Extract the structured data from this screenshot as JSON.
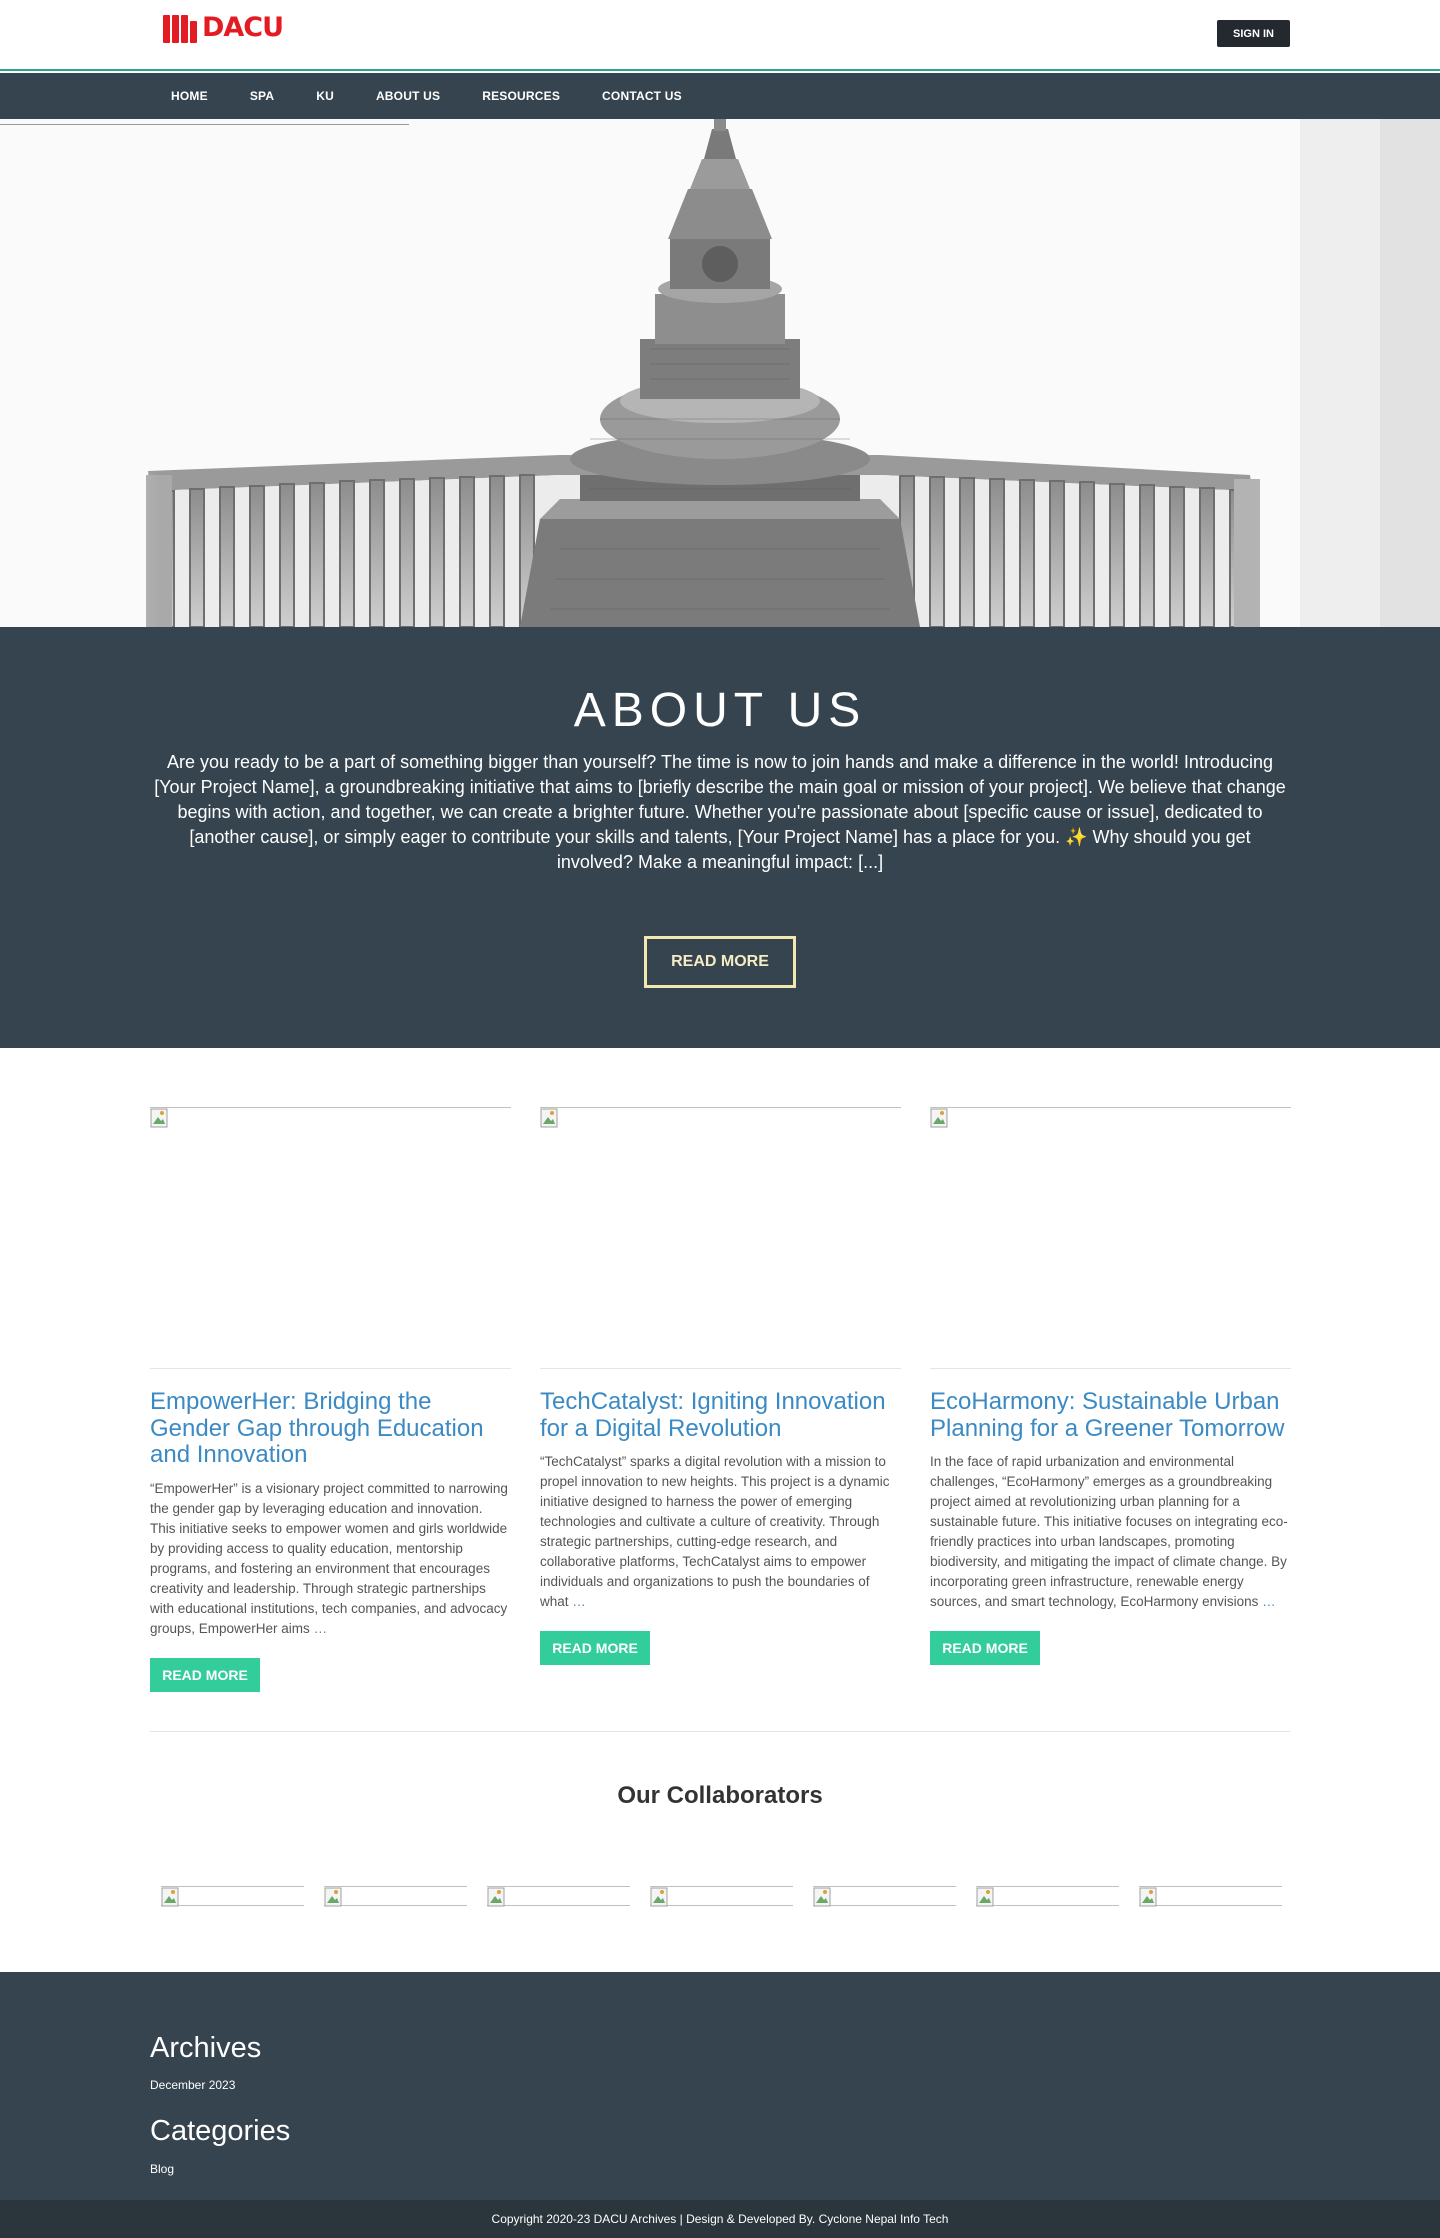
{
  "header": {
    "logo_text": "DACU",
    "signin_label": "SIGN IN",
    "accent_color": "#2aa58c"
  },
  "nav": {
    "items": [
      "HOME",
      "SPA",
      "KU",
      "ABOUT US",
      "RESOURCES",
      "CONTACT US"
    ]
  },
  "about": {
    "title": "ABOUT US",
    "body": "Are you ready to be a part of something bigger than yourself? The time is now to join hands and make a difference in the world! Introducing [Your Project Name], a groundbreaking initiative that aims to [briefly describe the main goal or mission of your project]. We believe that change begins with action, and together, we can create a brighter future. Whether you're passionate about [specific cause or issue], dedicated to [another cause], or simply eager to contribute your skills and talents, [Your Project Name] has a place for you. ✨ Why should you get involved? Make a meaningful impact: [...]",
    "button_label": "READ MORE"
  },
  "posts": [
    {
      "title": "EmpowerHer: Bridging the Gender Gap through Education and Innovation",
      "excerpt": "“EmpowerHer” is a visionary project committed to narrowing the gender gap by leveraging education and innovation. This initiative seeks to empower women and girls worldwide by providing access to quality education, mentorship programs, and fostering an environment that encourages creativity and leadership. Through strategic partnerships with educational institutions, tech companies, and advocacy groups, EmpowerHer aims",
      "more": "…",
      "button_label": "READ MORE"
    },
    {
      "title": "TechCatalyst: Igniting Innovation for a Digital Revolution",
      "excerpt": "“TechCatalyst” sparks a digital revolution with a mission to propel innovation to new heights. This project is a dynamic initiative designed to harness the power of emerging technologies and cultivate a culture of creativity. Through strategic partnerships, cutting-edge research, and collaborative platforms, TechCatalyst aims to empower individuals and organizations to push the boundaries of what",
      "more": "…",
      "button_label": "READ MORE"
    },
    {
      "title": "EcoHarmony: Sustainable Urban Planning for a Greener Tomorrow",
      "excerpt": "In the face of rapid urbanization and environmental challenges, “EcoHarmony” emerges as a groundbreaking project aimed at revolutionizing urban planning for a sustainable future. This initiative focuses on integrating eco-friendly practices into urban landscapes, promoting biodiversity, and mitigating the impact of climate change. By incorporating green infrastructure, renewable energy sources, and smart technology, EcoHarmony envisions",
      "more": "…",
      "button_label": "READ MORE"
    }
  ],
  "collaborators": {
    "title": "Our Collaborators",
    "count_shown": 7
  },
  "footer": {
    "archives_title": "Archives",
    "archives_item": "December 2023",
    "categories_title": "Categories",
    "categories_item": "Blog",
    "copyright": "Copyright 2020-23 DACU Archives | Design & Developed By. Cyclone Nepal Info Tech"
  }
}
